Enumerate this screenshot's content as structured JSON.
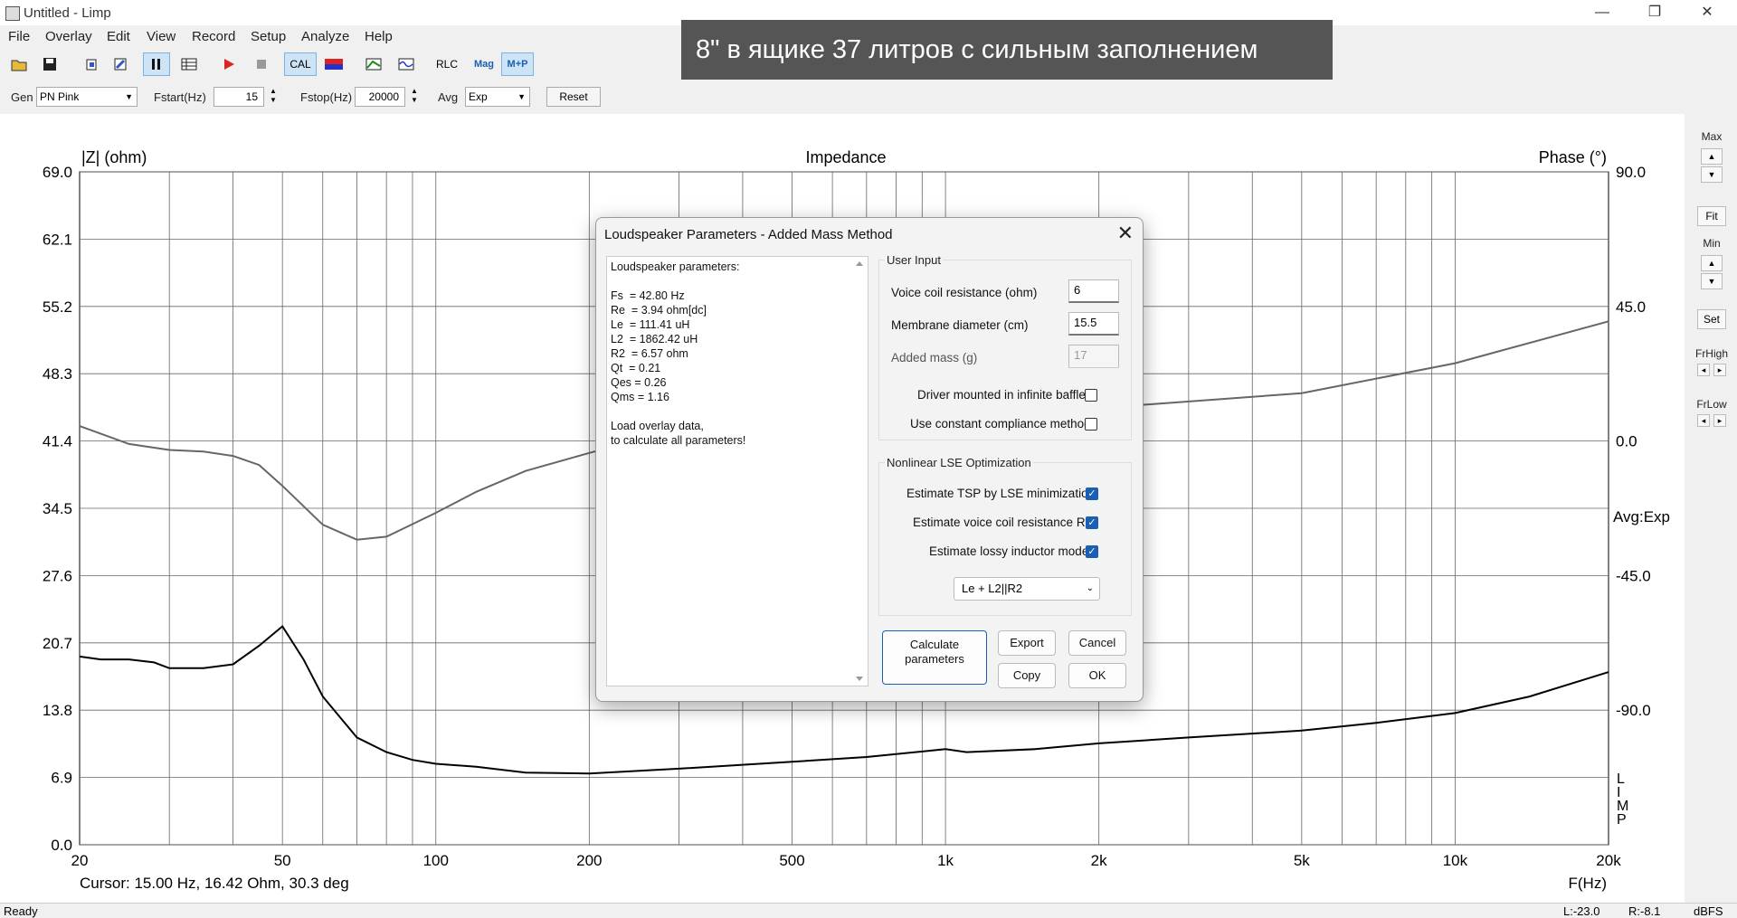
{
  "window": {
    "title": "Untitled - Limp",
    "minimize": "—",
    "restore": "❐",
    "close": "✕"
  },
  "menu": [
    "File",
    "Overlay",
    "Edit",
    "View",
    "Record",
    "Setup",
    "Analyze",
    "Help"
  ],
  "toolbar": {
    "cal": "CAL",
    "rlc": "RLC",
    "mag": "Mag",
    "mp": "M+P"
  },
  "gen": {
    "gen_label": "Gen",
    "gen_value": "PN Pink",
    "fstart_label": "Fstart(Hz)",
    "fstart_value": "15",
    "fstop_label": "Fstop(Hz)",
    "fstop_value": "20000",
    "avg_label": "Avg",
    "avg_value": "Exp",
    "reset": "Reset"
  },
  "overlay_caption": "8\" в ящике 37 литров с сильным заполнением",
  "chart_data": {
    "type": "line",
    "title": "Impedance",
    "ylabel": "|Z| (ohm)",
    "y2label": "Phase (°)",
    "xlabel": "F(Hz)",
    "xscale": "log",
    "xlim": [
      20,
      20000
    ],
    "ylim": [
      0,
      69
    ],
    "y2lim": [
      -135,
      90
    ],
    "yticks": [
      "69.0",
      "62.1",
      "55.2",
      "48.3",
      "41.4",
      "34.5",
      "27.6",
      "20.7",
      "13.8",
      "6.9",
      "0.0"
    ],
    "y2ticks": [
      "90.0",
      "45.0",
      "0.0",
      "-45.0",
      "-90.0"
    ],
    "xticks": [
      "20",
      "50",
      "100",
      "200",
      "500",
      "1k",
      "2k",
      "5k",
      "10k",
      "20k"
    ],
    "avg_label": "Avg:Exp",
    "side_label": "LIMP",
    "grid": true,
    "series": [
      {
        "color": "#000000",
        "axis": "left",
        "x": [
          20,
          22,
          25,
          28,
          30,
          35,
          40,
          45,
          50,
          55,
          60,
          70,
          80,
          90,
          100,
          120,
          150,
          200,
          300,
          500,
          700,
          1000,
          1100,
          1500,
          2000,
          3000,
          5000,
          7000,
          10000,
          14000,
          20000
        ],
        "y": [
          19.3,
          19.0,
          19.0,
          18.7,
          18.1,
          18.1,
          18.5,
          20.4,
          22.4,
          19.0,
          15.2,
          11.0,
          9.5,
          8.7,
          8.3,
          8.0,
          7.4,
          7.3,
          7.8,
          8.5,
          9.0,
          9.8,
          9.5,
          9.8,
          10.4,
          11.0,
          11.7,
          12.5,
          13.5,
          15.2,
          17.7
        ]
      },
      {
        "color": "#666666",
        "axis": "right",
        "x": [
          20,
          25,
          30,
          35,
          40,
          45,
          50,
          60,
          70,
          80,
          100,
          120,
          150,
          200,
          300,
          500,
          1000,
          2000,
          5000,
          10000,
          20000
        ],
        "y": [
          5,
          -1,
          -3,
          -3.5,
          -5,
          -8,
          -15,
          -28,
          -33,
          -32,
          -24,
          -17,
          -10,
          -4,
          4,
          10,
          11,
          11,
          16,
          26,
          40
        ]
      }
    ]
  },
  "cursor_text": "Cursor: 15.00 Hz, 16.42 Ohm, 30.3 deg",
  "right_panel": {
    "max": "Max",
    "fit": "Fit",
    "min": "Min",
    "set": "Set",
    "frhigh": "FrHigh",
    "frlow": "FrLow",
    "up": "▲",
    "down": "▼",
    "left": "◂",
    "right": "▸"
  },
  "status": {
    "ready": "Ready",
    "l": "L:-23.0",
    "r": "R:-8.1",
    "unit": "dBFS"
  },
  "dialog": {
    "title": "Loudspeaker Parameters - Added Mass Method",
    "close": "✕",
    "results": [
      "Loudspeaker parameters:",
      "",
      "Fs  = 42.80 Hz",
      "Re  = 3.94 ohm[dc]",
      "Le  = 111.41 uH",
      "L2  = 1862.42 uH",
      "R2  = 6.57 ohm",
      "Qt  = 0.21",
      "Qes = 0.26",
      "Qms = 1.16",
      "",
      "Load overlay data,",
      "to calculate all parameters!"
    ],
    "user_input": {
      "label": "User Input",
      "vc_label": "Voice coil resistance (ohm)",
      "vc_value": "6",
      "md_label": "Membrane diameter (cm)",
      "md_value": "15.5",
      "am_label": "Added mass (g)",
      "am_value": "17",
      "baffle_label": "Driver mounted in infinite baffle",
      "compliance_label": "Use constant compliance method"
    },
    "lse": {
      "label": "Nonlinear LSE Optimization",
      "tsp_label": "Estimate TSP by LSE minimization",
      "re_label": "Estimate voice coil resistance Re",
      "lossy_label": "Estimate lossy inductor model",
      "model_value": "Le + L2||R2"
    },
    "buttons": {
      "calc1": "Calculate",
      "calc2": "parameters",
      "export": "Export",
      "cancel": "Cancel",
      "copy": "Copy",
      "ok": "OK"
    }
  }
}
